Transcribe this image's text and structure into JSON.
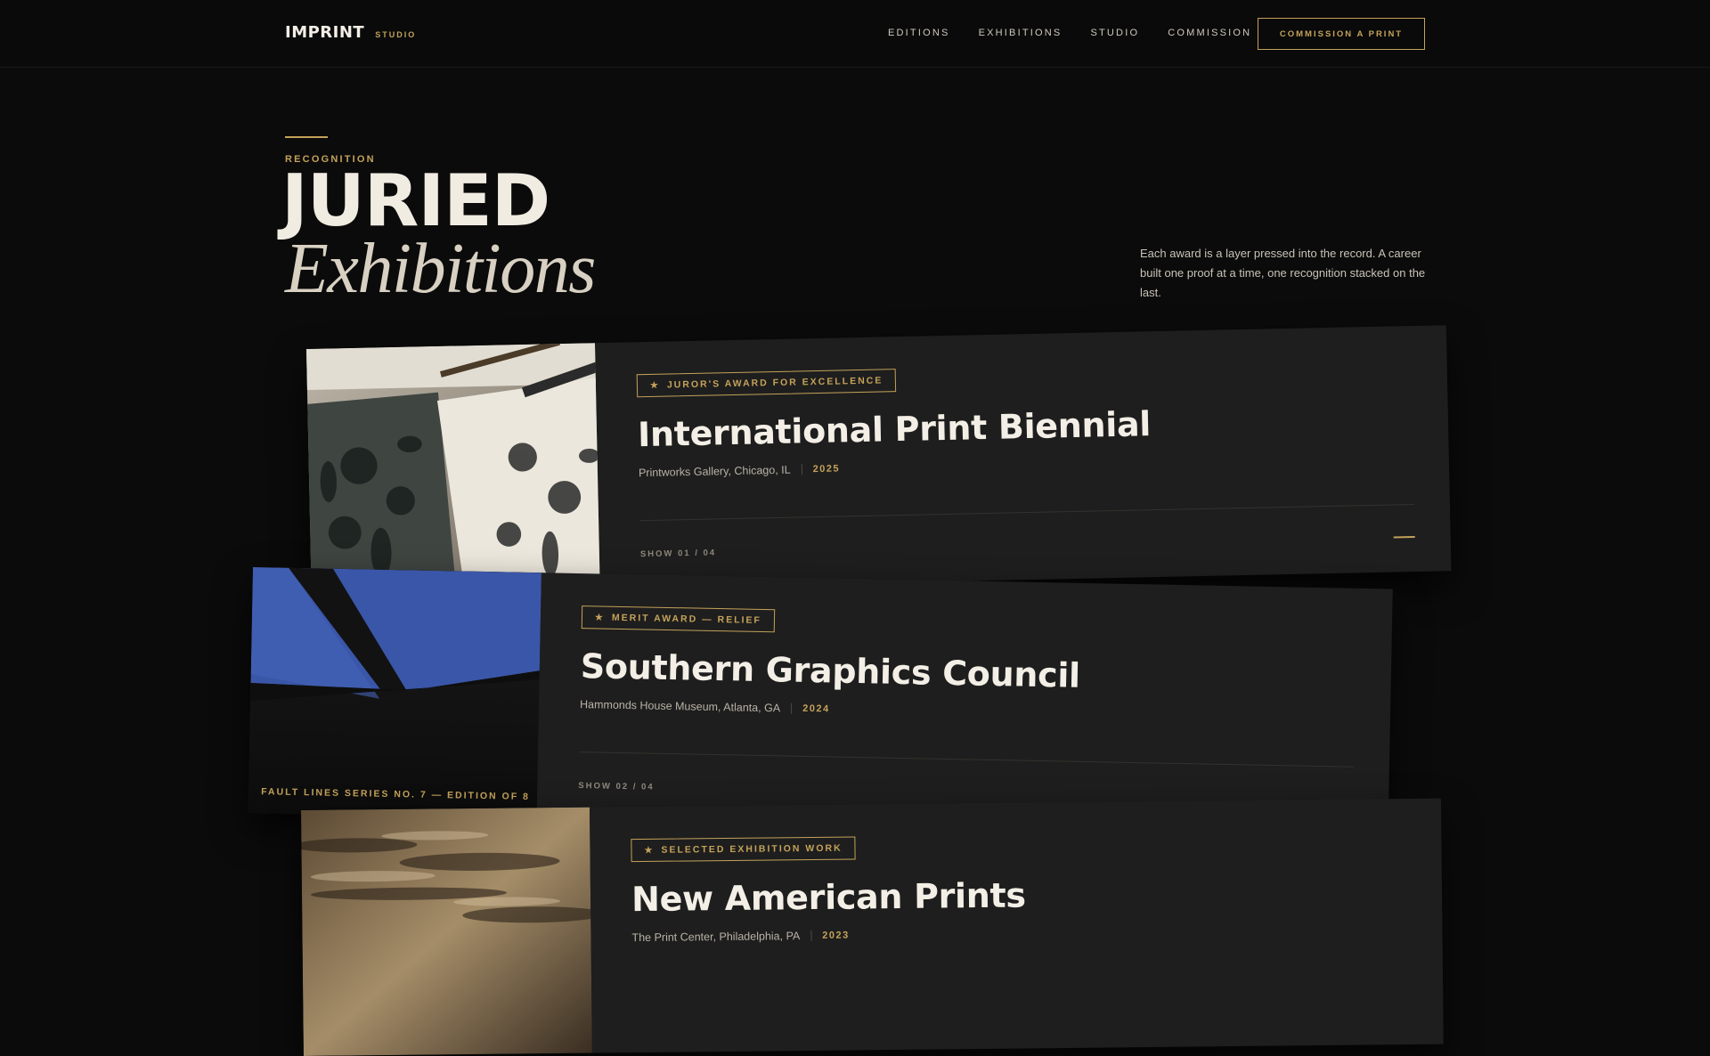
{
  "header": {
    "brand": "IMPRINT",
    "brand_sub": "STUDIO",
    "nav": [
      "EDITIONS",
      "EXHIBITIONS",
      "STUDIO",
      "COMMISSION"
    ],
    "cta": "COMMISSION A PRINT"
  },
  "hero": {
    "eyebrow": "RECOGNITION",
    "title_main": "JURIED",
    "title_italic": "Exhibitions",
    "lead": "Each award is a layer pressed into the record. A career built one proof at a time, one recognition stacked on the last."
  },
  "awards": [
    {
      "badge": "JUROR'S AWARD FOR EXCELLENCE",
      "title": "International Print Biennial",
      "venue": "Printworks Gallery, Chicago, IL",
      "year": "2025",
      "show": "SHOW 01 / 04",
      "image": "carved-woodblock-floral-print"
    },
    {
      "badge": "MERIT AWARD — RELIEF",
      "title": "Southern Graphics Council",
      "venue": "Hammonds House Museum, Atlanta, GA",
      "year": "2024",
      "show": "SHOW 02 / 04",
      "caption": "FAULT LINES SERIES NO. 7 — EDITION OF 8",
      "image": "blue-abstract-fault-lines"
    },
    {
      "badge": "SELECTED EXHIBITION WORK",
      "title": "New American Prints",
      "venue": "The Print Center, Philadelphia, PA",
      "year": "2023",
      "image": "rock-texture-print"
    }
  ],
  "colors": {
    "background": "#0b0b0b",
    "card": "#1e1e1e",
    "accent": "#c4a25a",
    "text": "#f3efe6"
  },
  "icons": {
    "badge": "star-icon",
    "card_more": "dash-icon"
  }
}
